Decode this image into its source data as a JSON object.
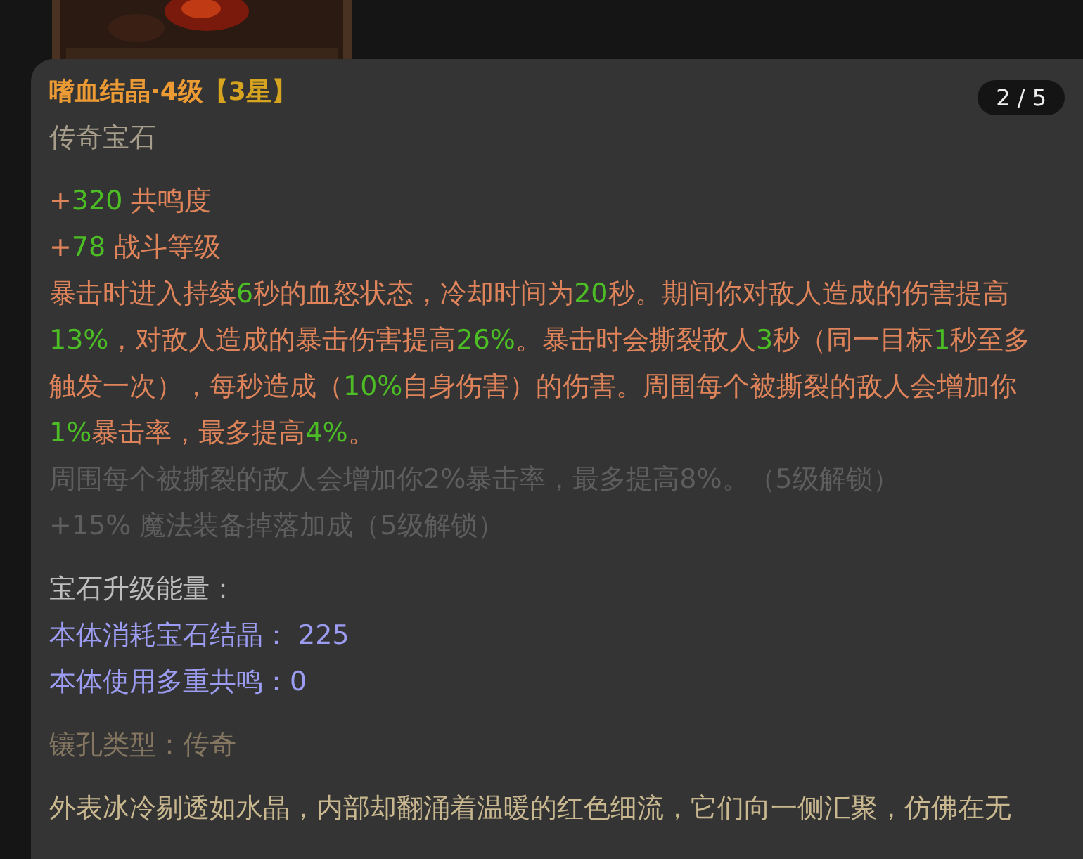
{
  "tooltip": {
    "title": "嗜血结晶·4级",
    "rank": "【3星】",
    "page": "2 / 5",
    "subtitle": "传奇宝石",
    "effects": [
      {
        "kind": "active",
        "segments": [
          {
            "text": "+",
            "value": false
          },
          {
            "text": "320",
            "value": true
          },
          {
            "text": " 共鸣度",
            "value": false
          }
        ]
      },
      {
        "kind": "active",
        "segments": [
          {
            "text": "+",
            "value": false
          },
          {
            "text": "78",
            "value": true
          },
          {
            "text": " 战斗等级",
            "value": false
          }
        ]
      },
      {
        "kind": "active",
        "segments": [
          {
            "text": "暴击时进入持续",
            "value": false
          },
          {
            "text": "6",
            "value": true
          },
          {
            "text": "秒的血怒状态，冷却时间为",
            "value": false
          },
          {
            "text": "20",
            "value": true
          },
          {
            "text": "秒。期间你对敌人造成的伤害提高",
            "value": false
          }
        ]
      },
      {
        "kind": "active",
        "segments": [
          {
            "text": "13%",
            "value": true
          },
          {
            "text": "，对敌人造成的暴击伤害提高",
            "value": false
          },
          {
            "text": "26%",
            "value": true
          },
          {
            "text": "。暴击时会撕裂敌人",
            "value": false
          },
          {
            "text": "3",
            "value": true
          },
          {
            "text": "秒（同一目标",
            "value": false
          },
          {
            "text": "1",
            "value": true
          },
          {
            "text": "秒至多",
            "value": false
          }
        ]
      },
      {
        "kind": "active",
        "segments": [
          {
            "text": "触发一次），每秒造成（",
            "value": false
          },
          {
            "text": "10%",
            "value": true
          },
          {
            "text": "自身伤害）的伤害。周围每个被撕裂的敌人会增加你",
            "value": false
          }
        ]
      },
      {
        "kind": "active",
        "segments": [
          {
            "text": "1%",
            "value": true
          },
          {
            "text": "暴击率，最多提高",
            "value": false
          },
          {
            "text": "4%",
            "value": true
          },
          {
            "text": "。",
            "value": false
          }
        ]
      },
      {
        "kind": "locked",
        "segments": [
          {
            "text": "周围每个被撕裂的敌人会增加你2%暴击率，最多提高8%。（5级解锁）",
            "value": false
          }
        ]
      },
      {
        "kind": "locked",
        "segments": [
          {
            "text": "+15% 魔法装备掉落加成（5级解锁）",
            "value": false
          }
        ]
      }
    ],
    "upgrade": {
      "heading": "宝石升级能量：",
      "rows": [
        "本体消耗宝石结晶：  225",
        "本体使用多重共鸣：0"
      ]
    },
    "socket": "镶孔类型：传奇",
    "lore": [
      "外表冰冷剔透如水晶，内部却翻涌着温暖的红色细流，它们向一侧汇聚，仿佛在无"
    ]
  }
}
